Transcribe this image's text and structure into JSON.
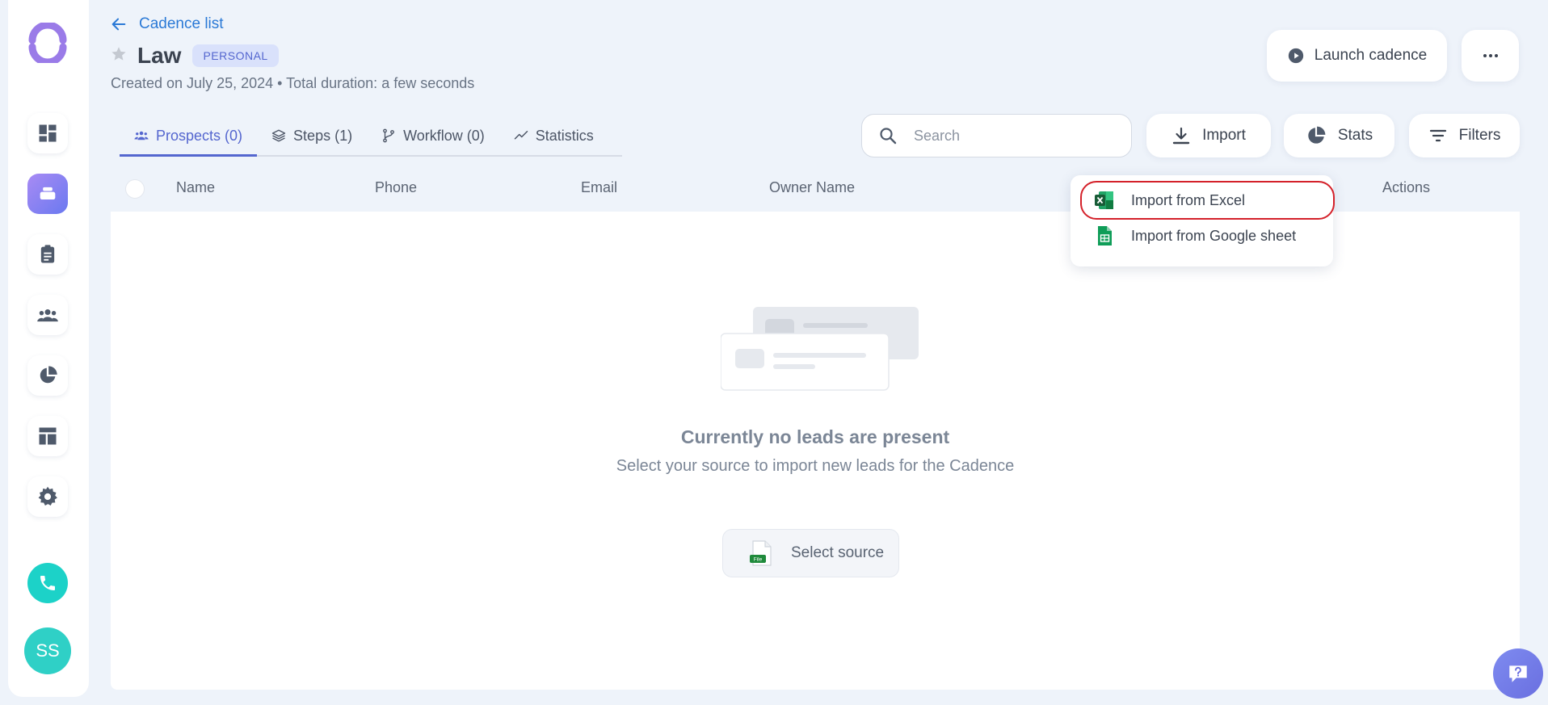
{
  "header": {
    "back_label": "Cadence list",
    "title": "Law",
    "badge": "PERSONAL",
    "subtitle": "Created on July 25, 2024 • Total duration: a few seconds",
    "launch_label": "Launch cadence"
  },
  "tabs": [
    {
      "label": "Prospects (0)",
      "icon": "users-icon"
    },
    {
      "label": "Steps (1)",
      "icon": "layers-icon"
    },
    {
      "label": "Workflow (0)",
      "icon": "branch-icon"
    },
    {
      "label": "Statistics",
      "icon": "trend-icon"
    }
  ],
  "toolbar": {
    "search_placeholder": "Search",
    "import_label": "Import",
    "stats_label": "Stats",
    "filters_label": "Filters"
  },
  "table": {
    "columns": [
      "Name",
      "Phone",
      "Email",
      "Owner Name",
      "Actions"
    ]
  },
  "empty": {
    "title": "Currently no leads are present",
    "subtitle": "Select your source to import new leads for the Cadence",
    "button_label": "Select source",
    "file_icon_text": "File"
  },
  "dropdown": {
    "items": [
      "Import from Excel",
      "Import from Google sheet"
    ]
  },
  "user": {
    "initials": "SS"
  },
  "colors": {
    "accent": "#5466cf",
    "link": "#2a79d6",
    "active_nav_start": "#a88bf4",
    "active_nav_end": "#6a79f0",
    "call": "#1cd2c8",
    "highlight": "#d4212a"
  }
}
